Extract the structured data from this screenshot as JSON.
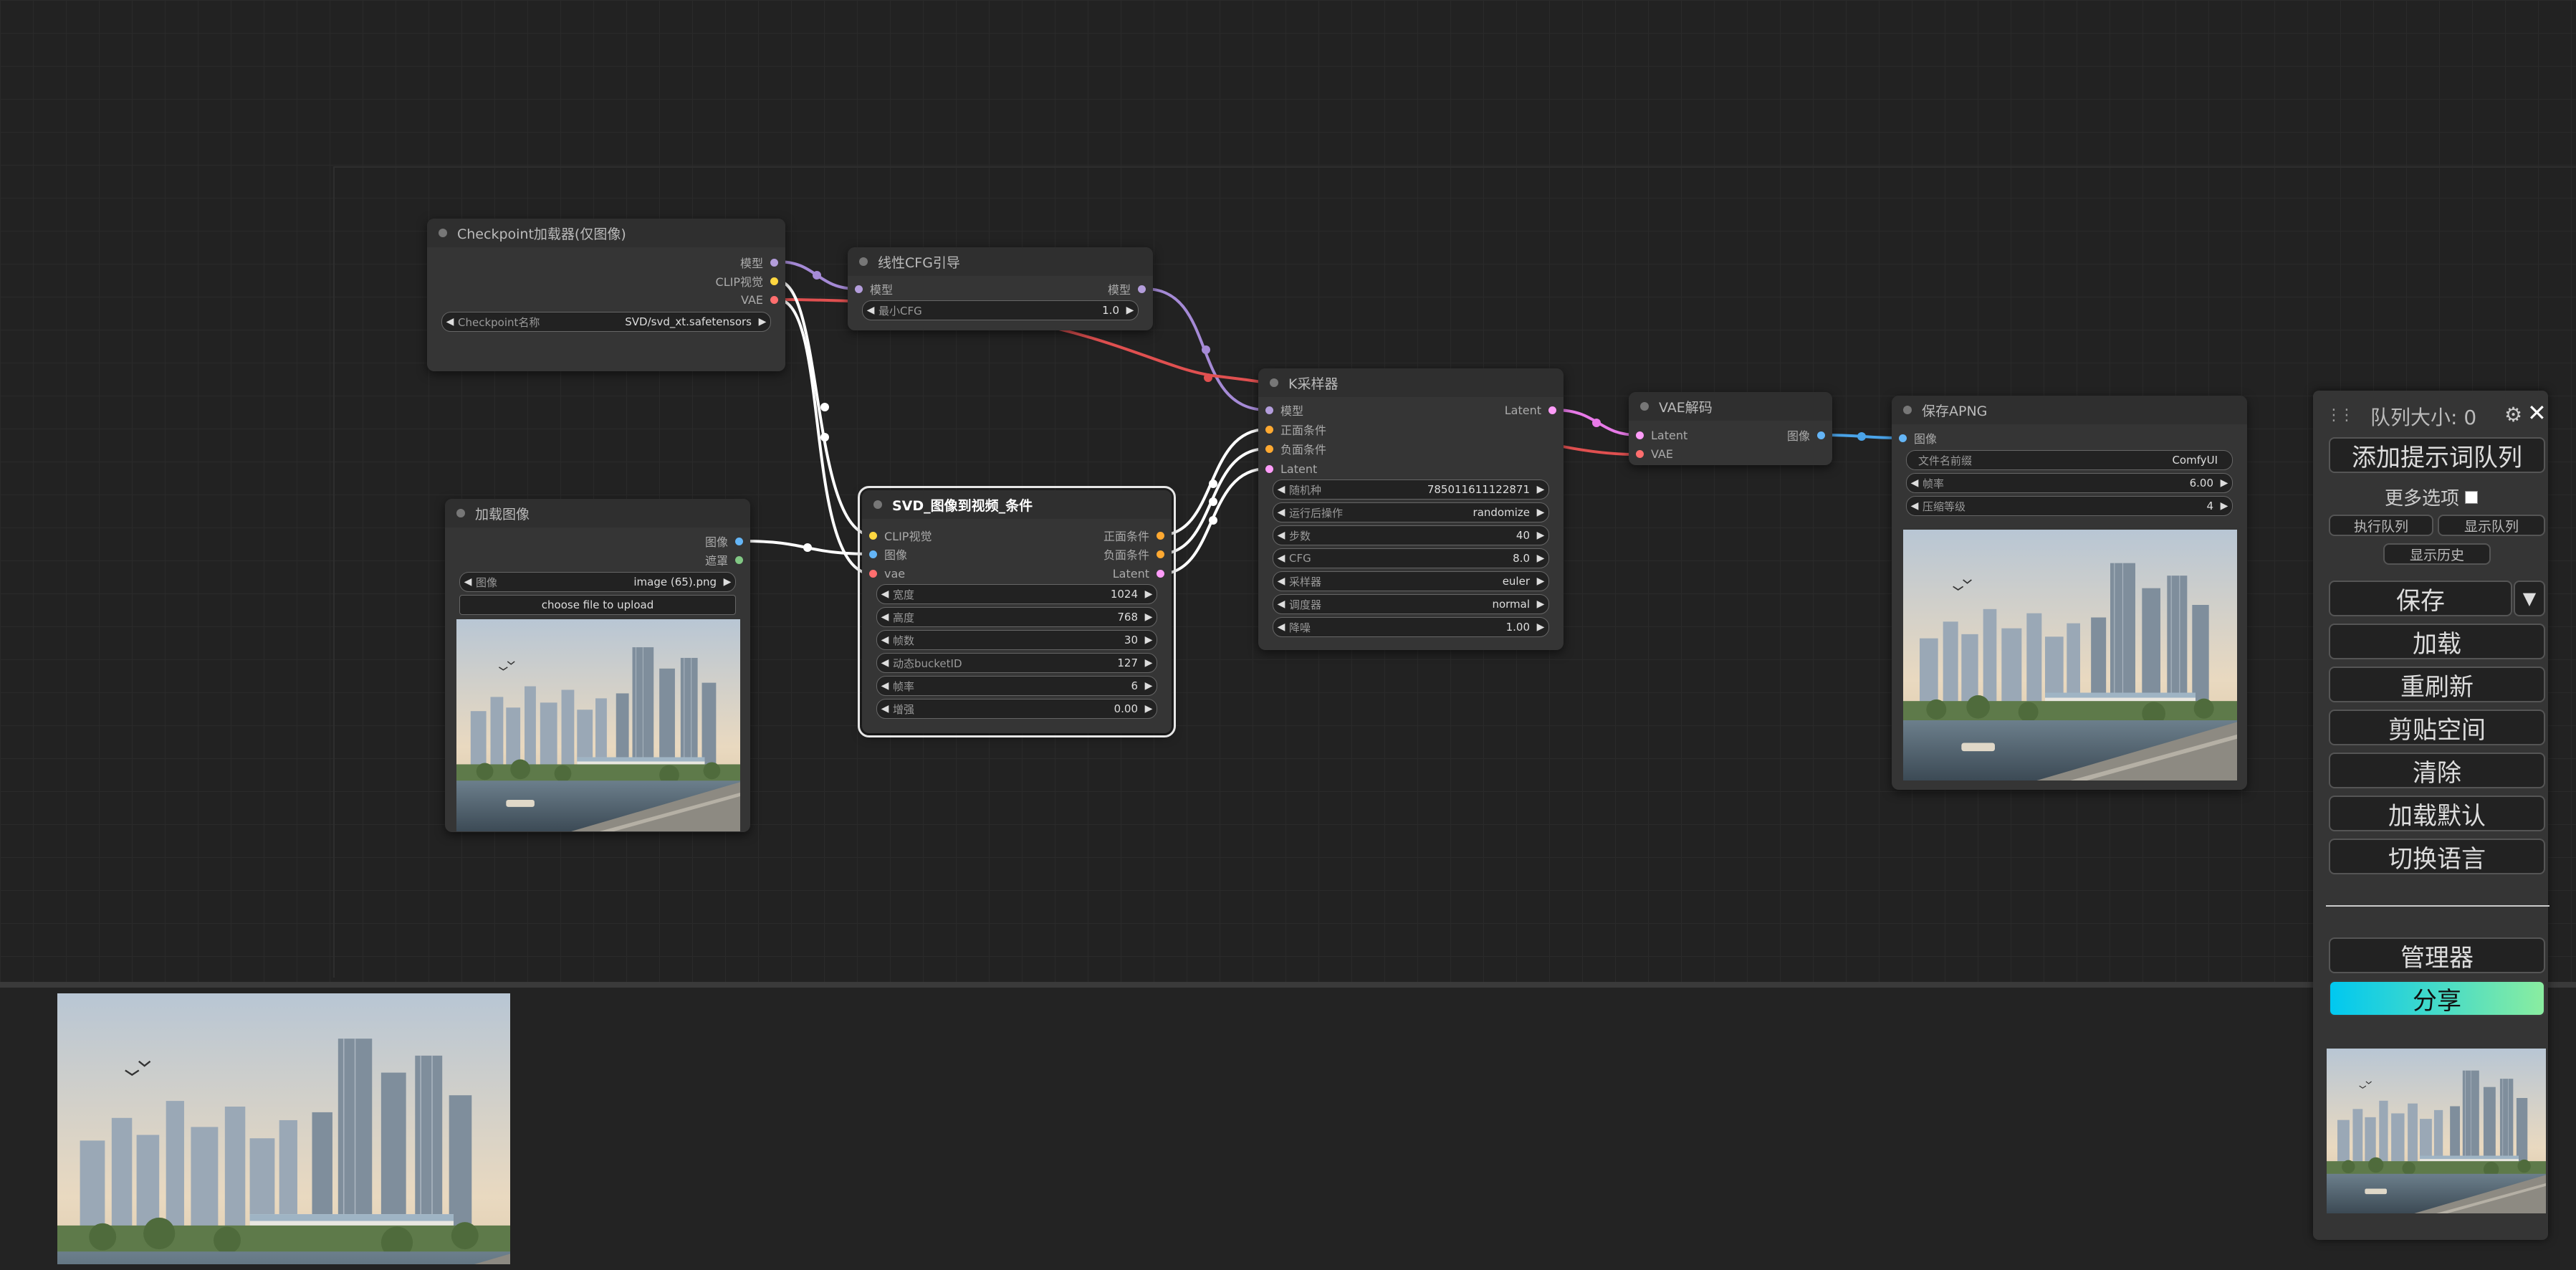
{
  "graph": {
    "checkpoint_loader": {
      "title": "Checkpoint加载器(仅图像)",
      "outputs": [
        "模型",
        "CLIP视觉",
        "VAE"
      ],
      "widgets": [
        {
          "label": "Checkpoint名称",
          "value": "SVD/svd_xt.safetensors"
        }
      ]
    },
    "linear_cfg": {
      "title": "线性CFG引导",
      "inputs": [
        "模型"
      ],
      "outputs": [
        "模型"
      ],
      "widgets": [
        {
          "label": "最小CFG",
          "value": "1.0"
        }
      ]
    },
    "load_image": {
      "title": "加载图像",
      "outputs": [
        "图像",
        "遮罩"
      ],
      "widgets": [
        {
          "label": "图像",
          "value": "image (65).png"
        }
      ],
      "upload_button": "choose file to upload"
    },
    "svd_conditioning": {
      "title": "SVD_图像到视频_条件",
      "inputs": [
        "CLIP视觉",
        "图像",
        "vae"
      ],
      "outputs": [
        "正面条件",
        "负面条件",
        "Latent"
      ],
      "widgets": [
        {
          "label": "宽度",
          "value": "1024"
        },
        {
          "label": "高度",
          "value": "768"
        },
        {
          "label": "帧数",
          "value": "30"
        },
        {
          "label": "动态bucketID",
          "value": "127"
        },
        {
          "label": "帧率",
          "value": "6"
        },
        {
          "label": "增强",
          "value": "0.00"
        }
      ]
    },
    "ksampler": {
      "title": "K采样器",
      "inputs": [
        "模型",
        "正面条件",
        "负面条件",
        "Latent"
      ],
      "outputs": [
        "Latent"
      ],
      "widgets": [
        {
          "label": "随机种",
          "value": "785011611122871"
        },
        {
          "label": "运行后操作",
          "value": "randomize"
        },
        {
          "label": "步数",
          "value": "40"
        },
        {
          "label": "CFG",
          "value": "8.0"
        },
        {
          "label": "采样器",
          "value": "euler"
        },
        {
          "label": "调度器",
          "value": "normal"
        },
        {
          "label": "降噪",
          "value": "1.00"
        }
      ]
    },
    "vae_decode": {
      "title": "VAE解码",
      "inputs": [
        "Latent",
        "VAE"
      ],
      "outputs": [
        "图像"
      ]
    },
    "save_apng": {
      "title": "保存APNG",
      "inputs": [
        "图像"
      ],
      "widgets": [
        {
          "label": "文件名前缀",
          "value": "ComfyUI"
        },
        {
          "label": "帧率",
          "value": "6.00"
        },
        {
          "label": "压缩等级",
          "value": "4"
        }
      ]
    }
  },
  "menu": {
    "queue_size": "队列大小: 0",
    "queue_prompt": "添加提示词队列",
    "more_options": "更多选项",
    "execute_queue": "执行队列",
    "view_queue": "显示队列",
    "view_history": "显示历史",
    "save": "保存",
    "load": "加载",
    "refresh": "重刷新",
    "clipspace": "剪贴空间",
    "clear": "清除",
    "load_default": "加载默认",
    "switch_language": "切换语言",
    "manager": "管理器",
    "share": "分享"
  },
  "icons": {
    "drag": "drag-handle-icon",
    "settings": "gear-icon",
    "close": "close-icon",
    "dropdown": "triangle-down-icon"
  },
  "colors": {
    "model": "#b39ddb",
    "clip_vision": "#ffd740",
    "vae": "#ff6e6e",
    "conditioning": "#ffa931",
    "latent": "#ff9cf9",
    "image": "#64b5f6",
    "mask": "#81c784",
    "share_gradient": [
      "#00c8f0",
      "#8aeda0"
    ]
  }
}
